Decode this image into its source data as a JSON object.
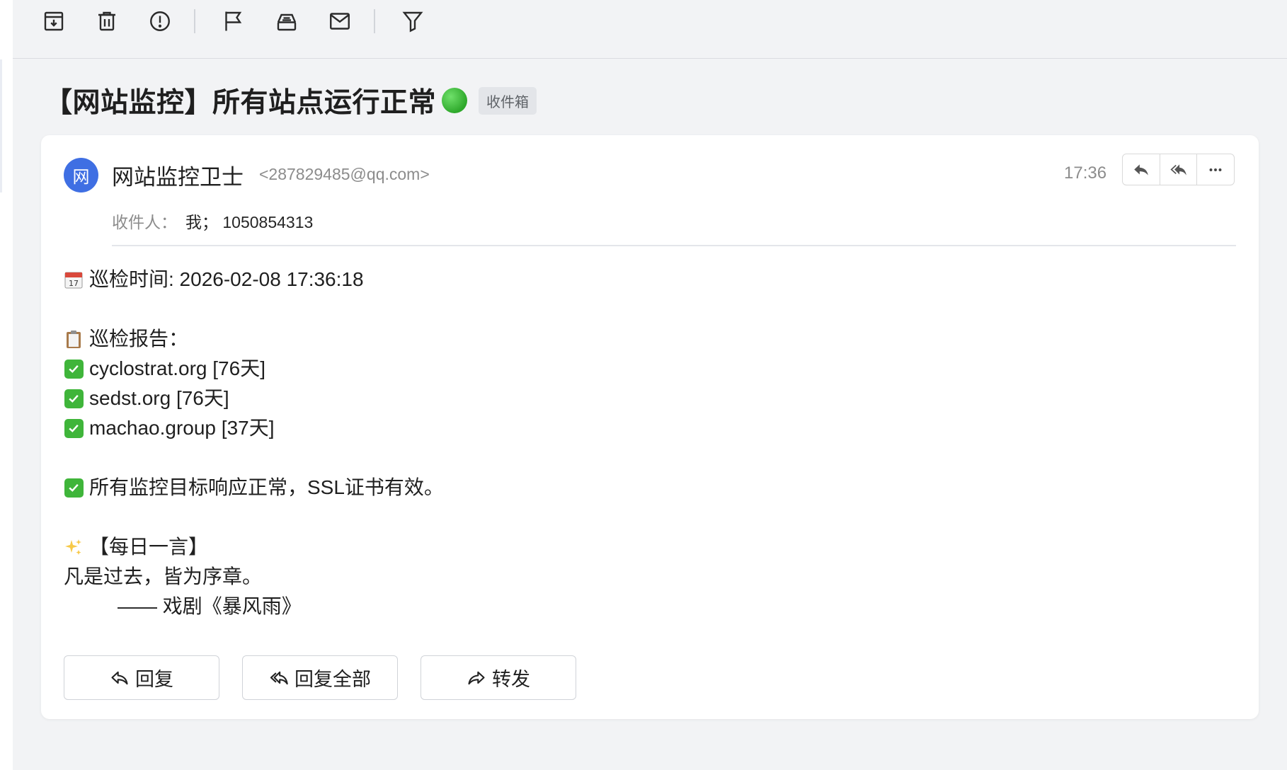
{
  "toolbar": {
    "items": [
      "archive-icon",
      "delete-icon",
      "spam-icon",
      "flag-icon",
      "move-icon",
      "mark-unread-icon",
      "filter-icon"
    ]
  },
  "subject": {
    "title": "【网站监控】所有站点运行正常",
    "folder_tag": "收件箱"
  },
  "sender": {
    "avatar_letter": "网",
    "name": "网站监控卫士",
    "email": "<287829485@qq.com>",
    "time": "17:36"
  },
  "recipients": {
    "label": "收件人：",
    "value": "我；  1050854313"
  },
  "body": {
    "patrol_time": "巡检时间: 2026-02-08 17:36:18",
    "report_heading": "巡检报告：",
    "sites": [
      "cyclostrat.org [76天]",
      "sedst.org [76天]",
      "machao.group [37天]"
    ],
    "summary": "所有监控目标响应正常，SSL证书有效。",
    "quote_heading": "【每日一言】",
    "quote": "凡是过去，皆为序章。",
    "quote_source": "—— 戏剧《暴风雨》",
    "calendar_date": "17"
  },
  "actions": {
    "reply": "回复",
    "reply_all": "回复全部",
    "forward": "转发"
  },
  "colors": {
    "accent": "#3f6fe3",
    "check_green": "#3fb53a",
    "status_green": "#2ea82b"
  }
}
